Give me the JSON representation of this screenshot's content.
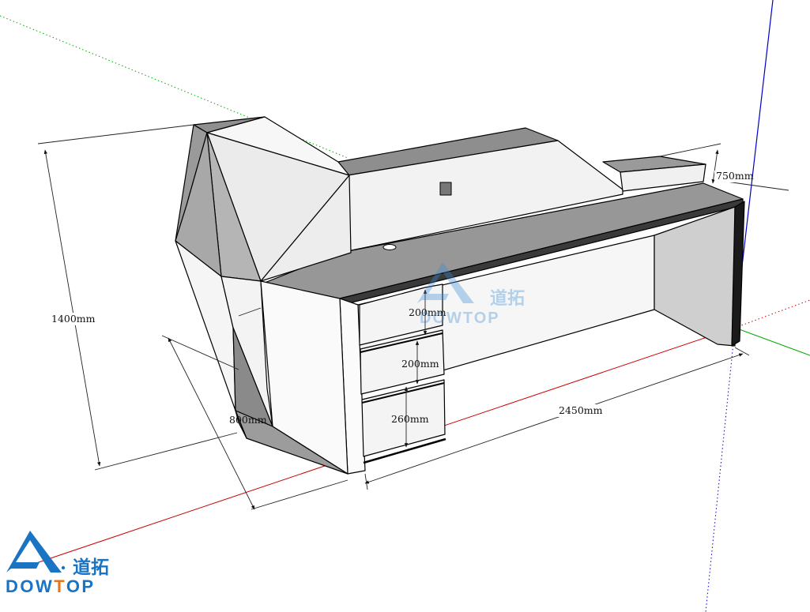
{
  "viewport": {
    "axes": {
      "red": "#cc0000",
      "green": "#00aa00",
      "blue": "#0000cc"
    }
  },
  "dimensions": {
    "height_total": "1400mm",
    "width_total": "2450mm",
    "riser_depth": "750mm",
    "drawer_1": "200mm",
    "drawer_2": "200mm",
    "drawer_3": "260mm",
    "depth": "800mm"
  },
  "brand": {
    "name_cn": "道拓",
    "name_en_prefix": "DOW",
    "name_en_t": "T",
    "name_en_suffix": "OP",
    "colors": {
      "blue": "#1a74c4",
      "orange": "#e8751a"
    }
  },
  "watermark": {
    "name_cn": "道拓",
    "name_en": "DOWTOP"
  }
}
